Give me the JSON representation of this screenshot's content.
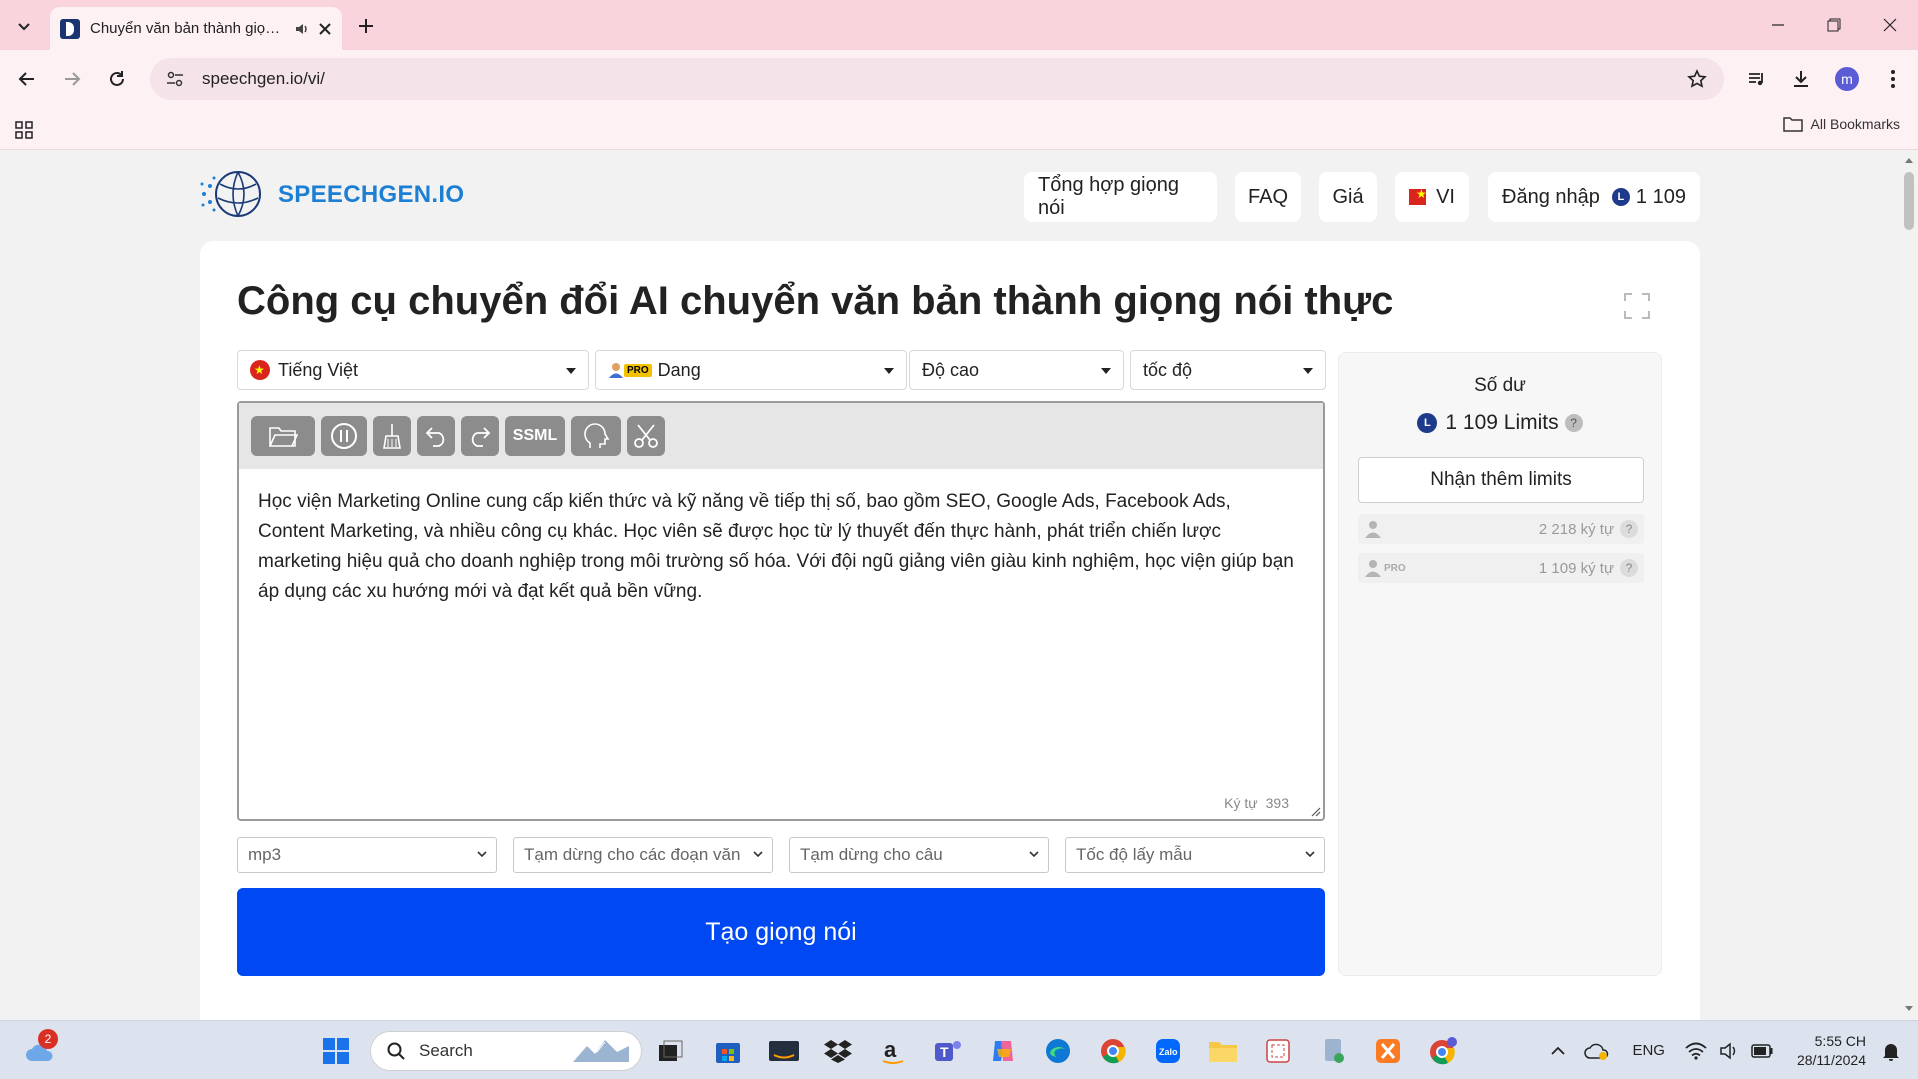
{
  "browser": {
    "tab_title": "Chuyển văn bản thành giọng nói",
    "url": "speechgen.io/vi/",
    "bookmarks_label": "All Bookmarks",
    "profile_initial": "m"
  },
  "site": {
    "logo_text": "SPEECHGEN.IO",
    "nav": {
      "synthesis": "Tổng hợp giọng nói",
      "faq": "FAQ",
      "pricing": "Giá",
      "lang": "VI",
      "login": "Đăng nhập",
      "balance": "1 109",
      "coin_letter": "L"
    }
  },
  "main": {
    "title": "Công cụ chuyển đổi AI chuyển văn bản thành giọng nói thực",
    "language": "Tiếng Việt",
    "voice_badge": "PRO",
    "voice": "Dang",
    "pitch": "Độ cao",
    "speed": "tốc độ",
    "ssml_label": "SSML",
    "text": "Học viện Marketing Online cung cấp kiến thức và kỹ năng về tiếp thị số, bao gồm SEO, Google Ads, Facebook Ads, Content Marketing, và nhiều công cụ khác. Học viên sẽ được học từ lý thuyết đến thực hành, phát triển chiến lược marketing hiệu quả cho doanh nghiệp trong môi trường số hóa. Với đội ngũ giảng viên giàu kinh nghiệm, học viện giúp bạn áp dụng các xu hướng mới và đạt kết quả bền vững.",
    "char_label": "Ký tự",
    "char_count": "393",
    "format": "mp3",
    "pause_paragraph": "Tạm dừng cho các đoạn văn",
    "pause_sentence": "Tạm dừng cho câu",
    "sample_rate": "Tốc độ lấy mẫu",
    "generate": "Tạo giọng nói"
  },
  "balance": {
    "label": "Số dư",
    "amount": "1 109 Limits",
    "get_more": "Nhận thêm limits",
    "standard_chars": "2 218 ký tự",
    "pro_badge": "PRO",
    "pro_chars": "1 109 ký tự",
    "help": "?"
  },
  "taskbar": {
    "search": "Search",
    "weather_badge": "2",
    "lang": "ENG",
    "time": "5:55 CH",
    "date": "28/11/2024"
  }
}
